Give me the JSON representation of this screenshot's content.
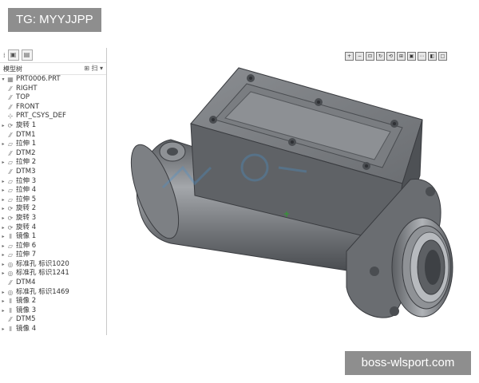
{
  "tag": {
    "text": "TG: MYYJJPP"
  },
  "badge": {
    "text": "boss-wlsport.com"
  },
  "tree": {
    "title": "模型树",
    "controls": "⊞ 扫 ▾",
    "root": "PRT0006.PRT",
    "items": [
      {
        "label": "RIGHT",
        "icon": "datum-plane-icon"
      },
      {
        "label": "TOP",
        "icon": "datum-plane-icon"
      },
      {
        "label": "FRONT",
        "icon": "datum-plane-icon"
      },
      {
        "label": "PRT_CSYS_DEF",
        "icon": "csys-icon"
      },
      {
        "label": "旋转 1",
        "icon": "revolve-icon"
      },
      {
        "label": "DTM1",
        "icon": "datum-plane-icon"
      },
      {
        "label": "拉伸 1",
        "icon": "extrude-icon"
      },
      {
        "label": "DTM2",
        "icon": "datum-plane-icon"
      },
      {
        "label": "拉伸 2",
        "icon": "extrude-icon"
      },
      {
        "label": "DTM3",
        "icon": "datum-plane-icon"
      },
      {
        "label": "拉伸 3",
        "icon": "extrude-icon"
      },
      {
        "label": "拉伸 4",
        "icon": "extrude-icon"
      },
      {
        "label": "拉伸 5",
        "icon": "extrude-icon"
      },
      {
        "label": "旋转 2",
        "icon": "revolve-icon"
      },
      {
        "label": "旋转 3",
        "icon": "revolve-icon"
      },
      {
        "label": "旋转 4",
        "icon": "revolve-icon"
      },
      {
        "label": "镜像 1",
        "icon": "mirror-icon"
      },
      {
        "label": "拉伸 6",
        "icon": "extrude-icon"
      },
      {
        "label": "拉伸 7",
        "icon": "extrude-icon"
      },
      {
        "label": "标准孔 标识1020",
        "icon": "hole-icon"
      },
      {
        "label": "标准孔 标识1241",
        "icon": "hole-icon"
      },
      {
        "label": "DTM4",
        "icon": "datum-plane-icon"
      },
      {
        "label": "标准孔 标识1469",
        "icon": "hole-icon"
      },
      {
        "label": "镜像 2",
        "icon": "mirror-icon"
      },
      {
        "label": "镜像 3",
        "icon": "mirror-icon"
      },
      {
        "label": "DTM5",
        "icon": "datum-plane-icon"
      },
      {
        "label": "镜像 4",
        "icon": "mirror-icon"
      }
    ]
  },
  "view_toolbar": {
    "buttons": [
      "zoom-in-icon",
      "zoom-out-icon",
      "refit-icon",
      "repaint-icon",
      "spin-icon",
      "orient-icon",
      "saved-views-icon",
      "datum-display-icon",
      "shading-icon",
      "wireframe-icon"
    ]
  },
  "colors": {
    "model_body": "#6e7175",
    "model_shadow": "#4f5256",
    "model_highlight": "#9a9da1",
    "badge_bg": "#8e8e8e"
  }
}
